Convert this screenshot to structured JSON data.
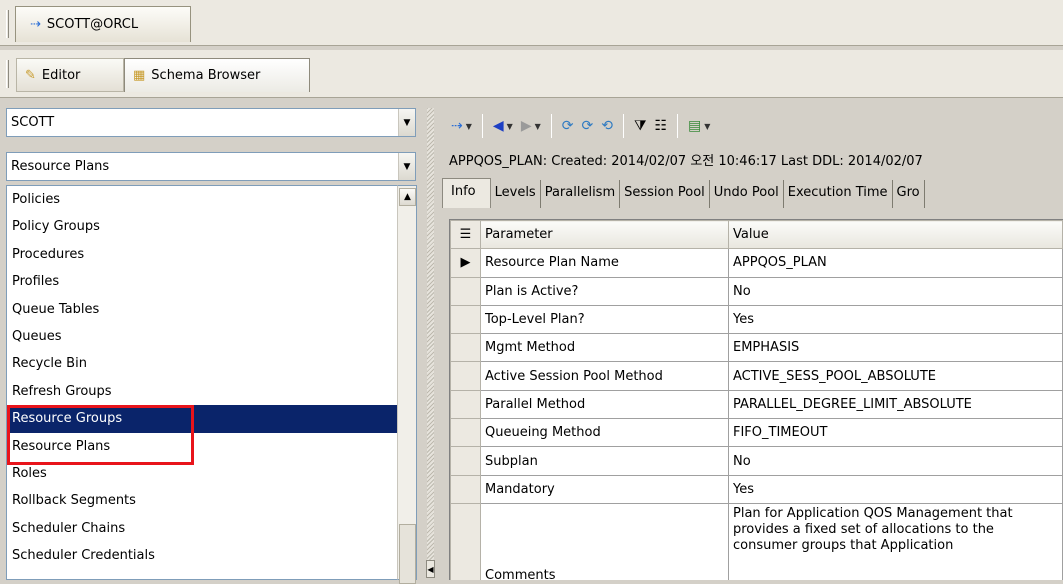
{
  "connection": {
    "tab_label": "SCOTT@ORCL"
  },
  "editor_tabs": {
    "editor": "Editor",
    "schema_browser": "Schema Browser"
  },
  "schema_select": {
    "value": "SCOTT"
  },
  "object_type_select": {
    "value": "Resource Plans"
  },
  "object_list": [
    {
      "label": "Policies",
      "selected": false
    },
    {
      "label": "Policy Groups",
      "selected": false
    },
    {
      "label": "Procedures",
      "selected": false
    },
    {
      "label": "Profiles",
      "selected": false
    },
    {
      "label": "Queue Tables",
      "selected": false
    },
    {
      "label": "Queues",
      "selected": false
    },
    {
      "label": "Recycle Bin",
      "selected": false
    },
    {
      "label": "Refresh Groups",
      "selected": false
    },
    {
      "label": "Resource Groups",
      "selected": true
    },
    {
      "label": "Resource Plans",
      "selected": false
    },
    {
      "label": "Roles",
      "selected": false
    },
    {
      "label": "Rollback Segments",
      "selected": false
    },
    {
      "label": "Scheduler Chains",
      "selected": false
    },
    {
      "label": "Scheduler Credentials",
      "selected": false
    }
  ],
  "object_header": "APPQOS_PLAN:  Created: 2014/02/07 오전 10:46:17  Last DDL: 2014/02/07",
  "detail_tabs": [
    "Info",
    "Levels",
    "Parallelism",
    "Session Pool",
    "Undo Pool",
    "Execution Time",
    "Gro"
  ],
  "grid": {
    "headers": {
      "parameter": "Parameter",
      "value": "Value"
    },
    "rows": [
      {
        "parameter": "Resource Plan Name",
        "value": "APPQOS_PLAN",
        "current": true
      },
      {
        "parameter": "Plan is Active?",
        "value": "No"
      },
      {
        "parameter": "Top-Level Plan?",
        "value": "Yes"
      },
      {
        "parameter": "Mgmt Method",
        "value": "EMPHASIS"
      },
      {
        "parameter": "Active Session Pool Method",
        "value": "ACTIVE_SESS_POOL_ABSOLUTE"
      },
      {
        "parameter": "Parallel Method",
        "value": "PARALLEL_DEGREE_LIMIT_ABSOLUTE"
      },
      {
        "parameter": "Queueing Method",
        "value": "FIFO_TIMEOUT"
      },
      {
        "parameter": "Subplan",
        "value": "No"
      },
      {
        "parameter": "Mandatory",
        "value": "Yes"
      },
      {
        "parameter": "Comments",
        "value": "Plan for Application QOS Management that provides a fixed set of allocations to the consumer groups that Application"
      }
    ]
  },
  "colors": {
    "selection": "#0a246a",
    "highlight_box": "#e8141b",
    "window_bg": "#d4d0c8"
  }
}
